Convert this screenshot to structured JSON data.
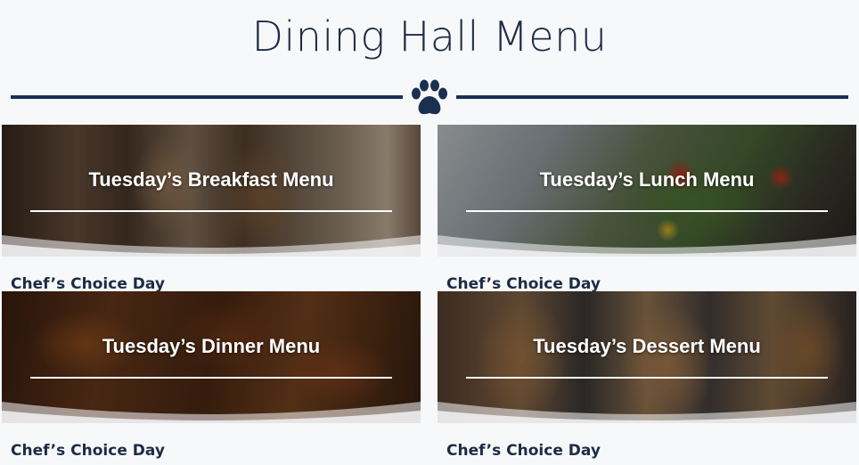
{
  "page": {
    "title": "Dining Hall Menu",
    "divider_icon": "paw-icon",
    "accent_color": "#1b2f50"
  },
  "menus": [
    {
      "title": "Tuesday’s Breakfast Menu",
      "subtitle": "Chef’s Choice Day"
    },
    {
      "title": "Tuesday’s Lunch Menu",
      "subtitle": "Chef’s Choice Day"
    },
    {
      "title": "Tuesday’s Dinner Menu",
      "subtitle": "Chef’s Choice Day"
    },
    {
      "title": "Tuesday’s Dessert Menu",
      "subtitle": "Chef’s Choice Day"
    }
  ]
}
